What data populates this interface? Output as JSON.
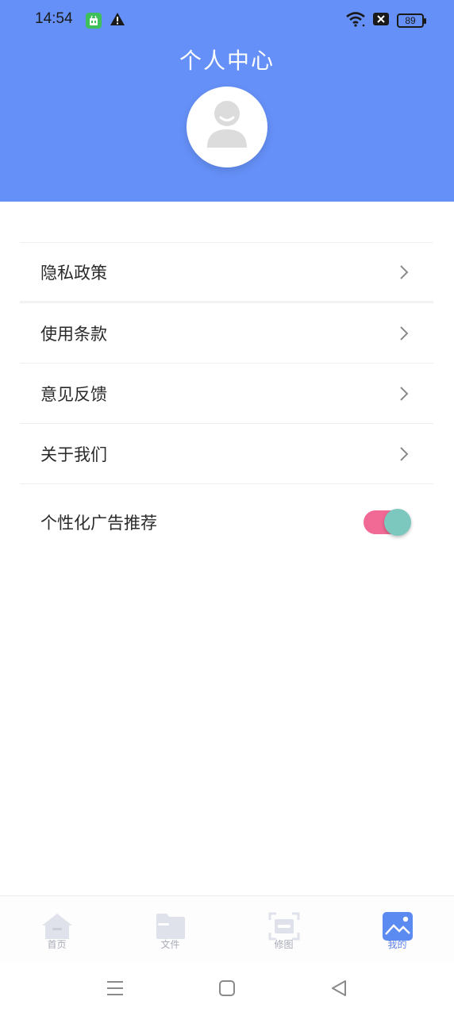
{
  "status_bar": {
    "time": "14:54",
    "battery": "89",
    "icons": [
      "app-notification-icon",
      "warning-icon",
      "wifi-icon",
      "sim-blocked-icon",
      "battery-icon"
    ]
  },
  "header": {
    "title": "个人中心",
    "background_color": "#6590f7",
    "avatar_icon": "default-user-avatar-icon"
  },
  "menu": {
    "items": [
      {
        "label": "隐私政策",
        "icon": "chevron-right-icon"
      },
      {
        "label": "使用条款",
        "icon": "chevron-right-icon"
      },
      {
        "label": "意见反馈",
        "icon": "chevron-right-icon"
      },
      {
        "label": "关于我们",
        "icon": "chevron-right-icon"
      }
    ],
    "ad_toggle": {
      "label": "个性化广告推荐",
      "state": "on",
      "track_color": "#f06a95",
      "knob_color": "#7cc8be"
    }
  },
  "tab_bar": {
    "active_color": "#5b7ee8",
    "tabs": [
      {
        "label": "首页",
        "icon": "home-icon",
        "active": false
      },
      {
        "label": "文件",
        "icon": "folder-icon",
        "active": false
      },
      {
        "label": "修图",
        "icon": "scan-edit-icon",
        "active": false
      },
      {
        "label": "我的",
        "icon": "image-profile-icon",
        "active": true
      }
    ]
  },
  "system_nav": {
    "buttons": [
      "menu-icon",
      "home-square-icon",
      "back-triangle-icon"
    ]
  }
}
